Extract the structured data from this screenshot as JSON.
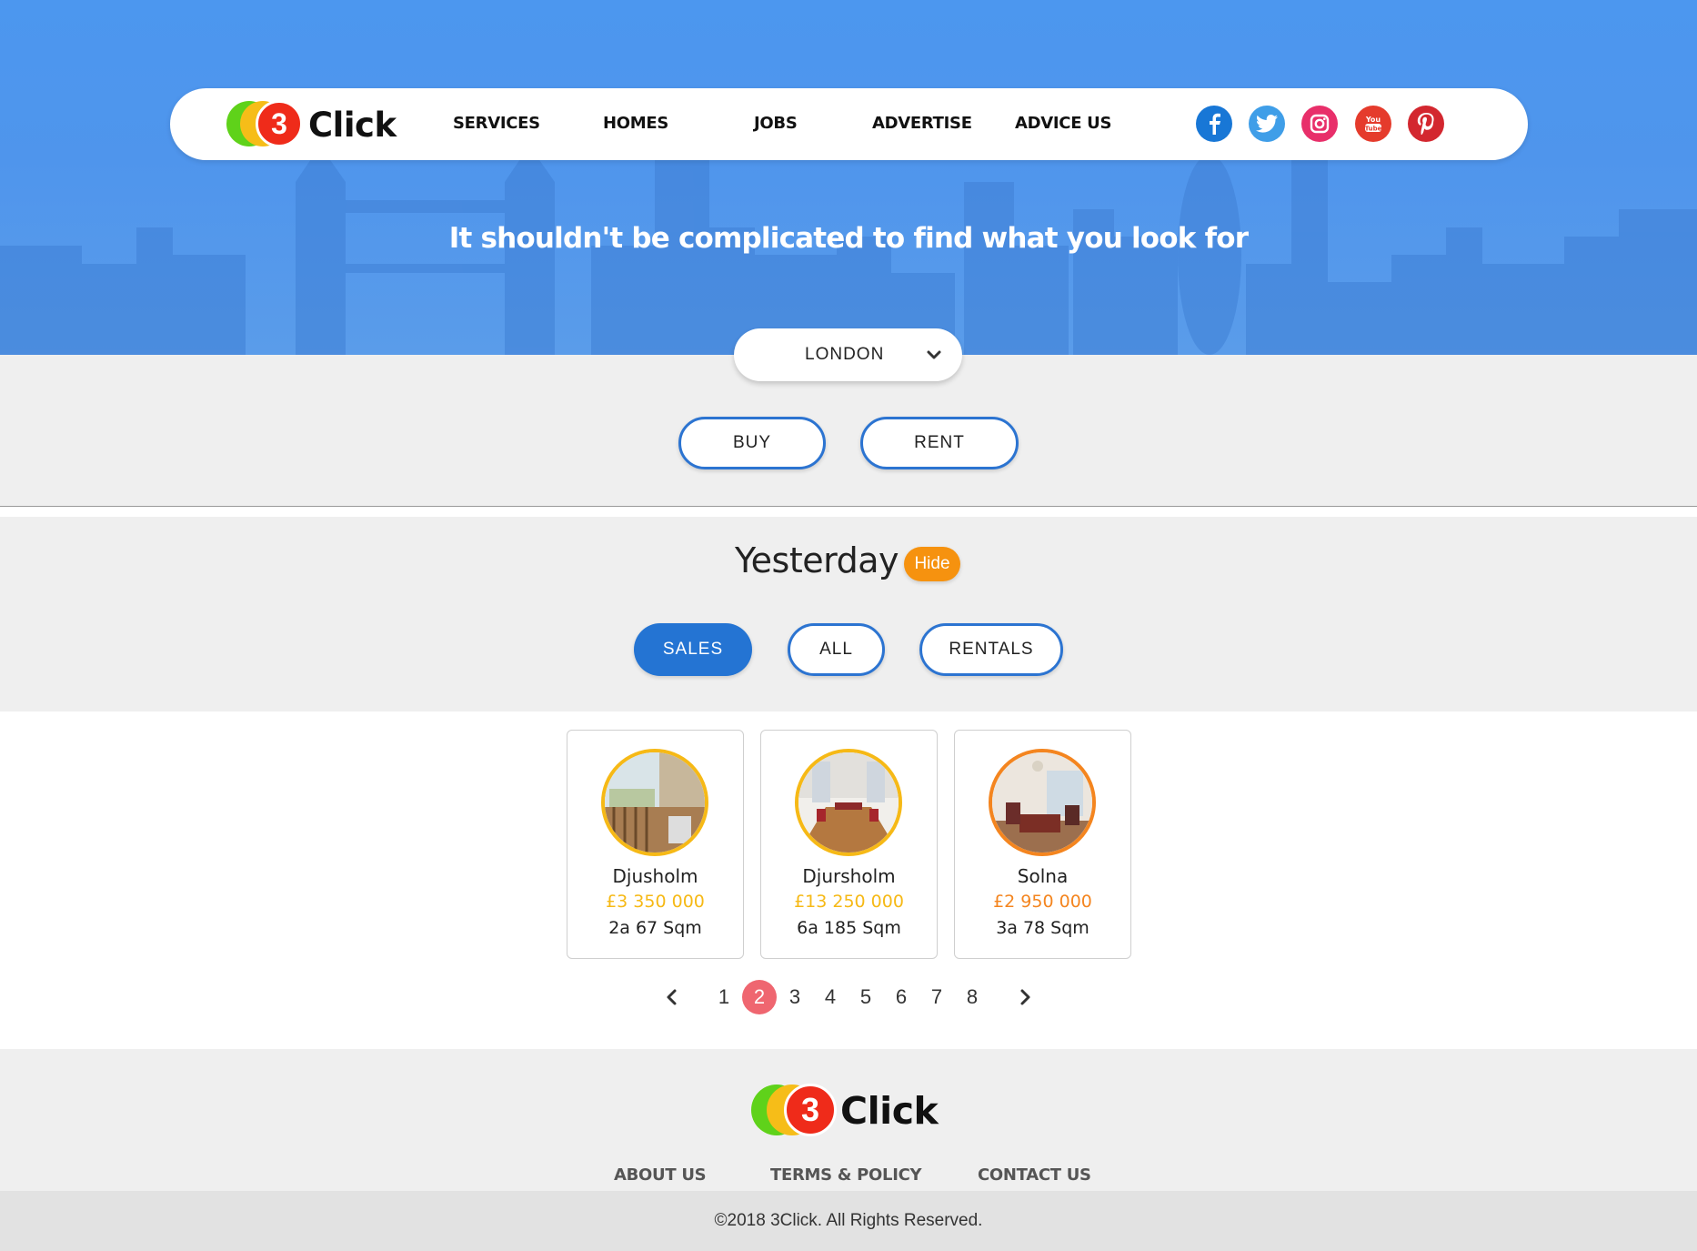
{
  "header": {
    "brand": "Click",
    "brand_digit": "3",
    "nav": [
      "SERVICES",
      "HOMES",
      "JOBS",
      "ADVERTISE",
      "ADVICE US"
    ],
    "social": [
      {
        "name": "facebook-icon",
        "glyph": "f",
        "color": "#1877d6"
      },
      {
        "name": "twitter-icon",
        "glyph": "t",
        "color": "#3f9ee8"
      },
      {
        "name": "instagram-icon",
        "glyph": "ig",
        "color": "#e82f6a"
      },
      {
        "name": "youtube-icon",
        "glyph": "You Tube",
        "color": "#e53b2c"
      },
      {
        "name": "pinterest-icon",
        "glyph": "p",
        "color": "#d3272f"
      }
    ]
  },
  "hero": {
    "tagline": "It shouldn't be complicated to find what you look for"
  },
  "search": {
    "city": "LONDON",
    "buy_label": "BUY",
    "rent_label": "RENT"
  },
  "listing": {
    "title": "Yesterday",
    "hide_label": "Hide",
    "tabs": [
      {
        "label": "SALES",
        "active": true
      },
      {
        "label": "ALL",
        "active": false
      },
      {
        "label": "RENTALS",
        "active": false
      }
    ],
    "cards": [
      {
        "name": "Djusholm",
        "price": "£3 350 000",
        "size": "2a 67 Sqm",
        "ring": "#f6b916",
        "price_color": "#f6b916"
      },
      {
        "name": "Djursholm",
        "price": "£13 250 000",
        "size": "6a 185 Sqm",
        "ring": "#f6b916",
        "price_color": "#f6b916"
      },
      {
        "name": "Solna",
        "price": "£2 950 000",
        "size": "3a 78 Sqm",
        "ring": "#f4851f",
        "price_color": "#f4851f"
      }
    ]
  },
  "pagination": {
    "pages": [
      "1",
      "2",
      "3",
      "4",
      "5",
      "6",
      "7",
      "8"
    ],
    "current": "2"
  },
  "footer": {
    "links": [
      "ABOUT US",
      "TERMS & POLICY",
      "CONTACT US"
    ],
    "copyright": "©2018 3Click. All Rights Reserved."
  }
}
